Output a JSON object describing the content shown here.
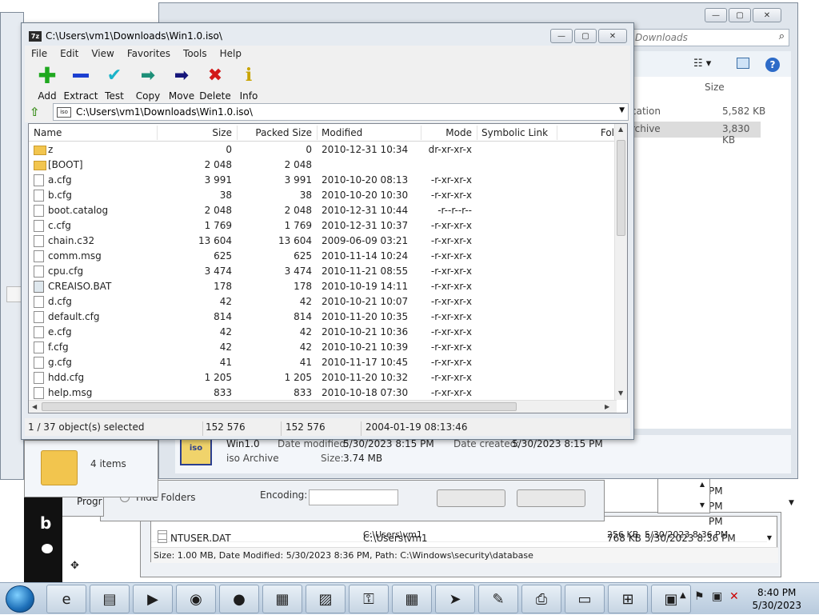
{
  "zip_window": {
    "title": "C:\\Users\\vm1\\Downloads\\Win1.0.iso\\",
    "menu": [
      "File",
      "Edit",
      "View",
      "Favorites",
      "Tools",
      "Help"
    ],
    "toolbar": [
      {
        "label": "Add",
        "icon": "plus-icon",
        "color": "#1fa81f"
      },
      {
        "label": "Extract",
        "icon": "minus-icon",
        "color": "#1c3fd1"
      },
      {
        "label": "Test",
        "icon": "check-icon",
        "color": "#1ab3c9"
      },
      {
        "label": "Copy",
        "icon": "copy-arrow-icon",
        "color": "#1d8f78"
      },
      {
        "label": "Move",
        "icon": "move-arrow-icon",
        "color": "#15157a"
      },
      {
        "label": "Delete",
        "icon": "delete-x-icon",
        "color": "#d21a1a"
      },
      {
        "label": "Info",
        "icon": "info-icon",
        "color": "#c9a400"
      }
    ],
    "address": "C:\\Users\\vm1\\Downloads\\Win1.0.iso\\",
    "columns": [
      "Name",
      "Size",
      "Packed Size",
      "Modified",
      "Mode",
      "Symbolic Link",
      "Fol"
    ],
    "rows": [
      {
        "type": "folder",
        "name": "z",
        "size": "0",
        "packed": "0",
        "modified": "2010-12-31 10:34",
        "mode": "dr-xr-xr-x"
      },
      {
        "type": "folder",
        "name": "[BOOT]",
        "size": "2 048",
        "packed": "2 048",
        "modified": "",
        "mode": ""
      },
      {
        "type": "file",
        "name": "a.cfg",
        "size": "3 991",
        "packed": "3 991",
        "modified": "2010-10-20 08:13",
        "mode": "-r-xr-xr-x"
      },
      {
        "type": "file",
        "name": "b.cfg",
        "size": "38",
        "packed": "38",
        "modified": "2010-10-20 10:30",
        "mode": "-r-xr-xr-x"
      },
      {
        "type": "file",
        "name": "boot.catalog",
        "size": "2 048",
        "packed": "2 048",
        "modified": "2010-12-31 10:44",
        "mode": "-r--r--r--"
      },
      {
        "type": "file",
        "name": "c.cfg",
        "size": "1 769",
        "packed": "1 769",
        "modified": "2010-12-31 10:37",
        "mode": "-r-xr-xr-x"
      },
      {
        "type": "file",
        "name": "chain.c32",
        "size": "13 604",
        "packed": "13 604",
        "modified": "2009-06-09 03:21",
        "mode": "-r-xr-xr-x"
      },
      {
        "type": "file",
        "name": "comm.msg",
        "size": "625",
        "packed": "625",
        "modified": "2010-11-14 10:24",
        "mode": "-r-xr-xr-x"
      },
      {
        "type": "file",
        "name": "cpu.cfg",
        "size": "3 474",
        "packed": "3 474",
        "modified": "2010-11-21 08:55",
        "mode": "-r-xr-xr-x"
      },
      {
        "type": "bat",
        "name": "CREAISO.BAT",
        "size": "178",
        "packed": "178",
        "modified": "2010-10-19 14:11",
        "mode": "-r-xr-xr-x"
      },
      {
        "type": "file",
        "name": "d.cfg",
        "size": "42",
        "packed": "42",
        "modified": "2010-10-21 10:07",
        "mode": "-r-xr-xr-x"
      },
      {
        "type": "file",
        "name": "default.cfg",
        "size": "814",
        "packed": "814",
        "modified": "2010-11-20 10:35",
        "mode": "-r-xr-xr-x"
      },
      {
        "type": "file",
        "name": "e.cfg",
        "size": "42",
        "packed": "42",
        "modified": "2010-10-21 10:36",
        "mode": "-r-xr-xr-x"
      },
      {
        "type": "file",
        "name": "f.cfg",
        "size": "42",
        "packed": "42",
        "modified": "2010-10-21 10:39",
        "mode": "-r-xr-xr-x"
      },
      {
        "type": "file",
        "name": "g.cfg",
        "size": "41",
        "packed": "41",
        "modified": "2010-11-17 10:45",
        "mode": "-r-xr-xr-x"
      },
      {
        "type": "file",
        "name": "hdd.cfg",
        "size": "1 205",
        "packed": "1 205",
        "modified": "2010-11-20 10:32",
        "mode": "-r-xr-xr-x"
      },
      {
        "type": "file",
        "name": "help.msg",
        "size": "833",
        "packed": "833",
        "modified": "2010-10-18 07:30",
        "mode": "-r-xr-xr-x"
      }
    ],
    "status": {
      "selected": "1 / 37 object(s) selected",
      "size": "152 576",
      "packed": "152 576",
      "date": "2004-01-19 08:13:46"
    }
  },
  "explorer_window": {
    "search_placeholder": "Downloads",
    "size_header": "Size",
    "items": [
      {
        "name_fragment": "cation",
        "size": "5,582 KB"
      },
      {
        "name_fragment": "rchive",
        "size": "3,830 KB"
      }
    ],
    "details": {
      "name": "Win1.0",
      "type": "iso Archive",
      "date_modified_label": "Date modified:",
      "date_modified": "5/30/2023 8:15 PM",
      "date_created_label": "Date created:",
      "date_created": "5/30/2023 8:15 PM",
      "size_label": "Size:",
      "size": "3.74 MB"
    },
    "item_count": "4 items"
  },
  "lower_windows": {
    "hide_folders": "Hide Folders",
    "encoding": "Encoding:",
    "prog": "Progr",
    "file_row": {
      "name": "NTUSER.DAT",
      "path": "C:\\Users\\vm1",
      "size": "768 KB",
      "date": "5/30/2023 8:36 PM"
    },
    "file_row_partial": {
      "path": "C:\\Users\\vm1",
      "size": "256 KB",
      "date": "5/30/2023 8:36 PM"
    },
    "extra_dates": [
      "PM",
      "PM",
      "PM"
    ],
    "status": "Size: 1.00 MB, Date Modified: 5/30/2023 8:36 PM, Path: C:\\Windows\\security\\database"
  },
  "taskbar": {
    "time": "8:40 PM",
    "date": "5/30/2023",
    "apps": [
      "ie-icon",
      "explorer-icon",
      "media-player-icon",
      "chrome-icon",
      "firefox-icon",
      "notes-icon",
      "photo-icon",
      "keys-icon",
      "calculator-icon",
      "send-icon",
      "paint-icon",
      "fax-icon",
      "document-icon",
      "windows-icon",
      "network-icon"
    ]
  }
}
